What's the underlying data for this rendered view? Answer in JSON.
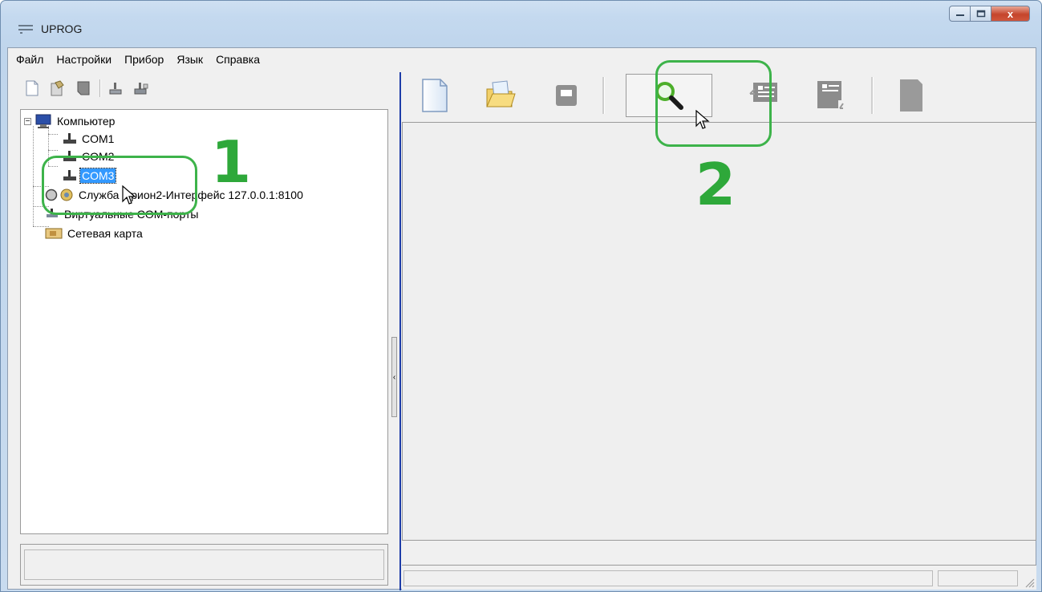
{
  "window": {
    "title": "UPROG",
    "controls": {
      "minimize": "–",
      "maximize": "□",
      "close": "x"
    }
  },
  "menu": {
    "items": [
      "Файл",
      "Настройки",
      "Прибор",
      "Язык",
      "Справка"
    ]
  },
  "left_toolbar": {
    "icons": [
      "new-doc-icon",
      "properties-icon",
      "save-icon",
      "port-icon",
      "port-settings-icon"
    ]
  },
  "tree": {
    "root_label": "Компьютер",
    "ports": [
      "COM1",
      "COM2",
      "COM3"
    ],
    "selected": "COM3",
    "service_label": "Служба Орион2-Интерфейс 127.0.0.1:8100",
    "virtual_ports_label": "Виртуальные COM-порты",
    "network_card_label": "Сетевая карта"
  },
  "right_toolbar": {
    "icons": [
      "new-file-icon",
      "open-folder-icon",
      "save-disk-icon",
      "search-icon",
      "read-config-icon",
      "write-config-icon",
      "blank-doc-icon"
    ]
  },
  "annotations": {
    "step1": "1",
    "step2": "2",
    "color": "#3db34a"
  },
  "colors": {
    "selection": "#3399ff",
    "divider": "#1e3da8"
  }
}
